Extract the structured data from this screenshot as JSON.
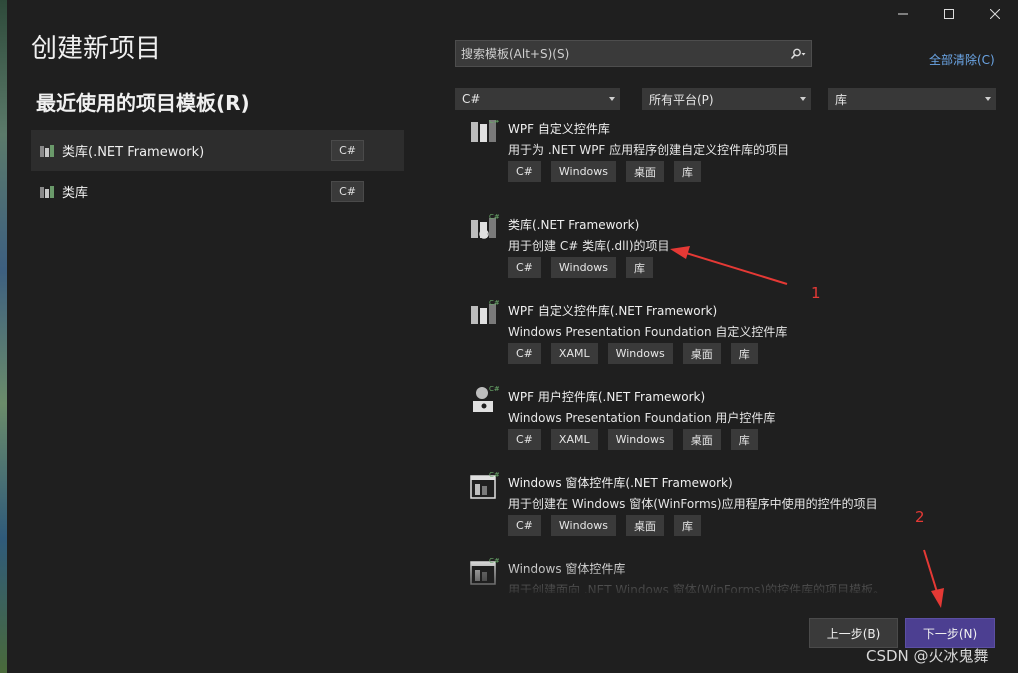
{
  "window": {
    "controls": [
      "minimize",
      "maximize",
      "close"
    ]
  },
  "page": {
    "title": "创建新项目",
    "recent_title": "最近使用的项目模板(R)",
    "recent_items": [
      {
        "label": "类库(.NET Framework)",
        "lang": "C#"
      },
      {
        "label": "类库",
        "lang": "C#"
      }
    ]
  },
  "search": {
    "placeholder": "搜索模板(Alt+S)(S)"
  },
  "clear_all": "全部清除(C)",
  "filters": {
    "language": "C#",
    "platform": "所有平台(P)",
    "project_type": "库"
  },
  "templates": [
    {
      "name": "WPF 自定义控件库",
      "desc": "用于为 .NET WPF 应用程序创建自定义控件库的项目",
      "tags": [
        "C#",
        "Windows",
        "桌面",
        "库"
      ]
    },
    {
      "name": "类库(.NET Framework)",
      "desc": "用于创建 C# 类库(.dll)的项目",
      "tags": [
        "C#",
        "Windows",
        "库"
      ]
    },
    {
      "name": "WPF 自定义控件库(.NET Framework)",
      "desc": "Windows Presentation Foundation 自定义控件库",
      "tags": [
        "C#",
        "XAML",
        "Windows",
        "桌面",
        "库"
      ]
    },
    {
      "name": "WPF 用户控件库(.NET Framework)",
      "desc": "Windows Presentation Foundation 用户控件库",
      "tags": [
        "C#",
        "XAML",
        "Windows",
        "桌面",
        "库"
      ]
    },
    {
      "name": "Windows 窗体控件库(.NET Framework)",
      "desc": "用于创建在 Windows 窗体(WinForms)应用程序中使用的控件的项目",
      "tags": [
        "C#",
        "Windows",
        "桌面",
        "库"
      ]
    },
    {
      "name": "Windows 窗体控件库",
      "desc": "用于创建面向 .NET Windows 窗体(WinForms)的控件库的项目模板。",
      "tags": []
    }
  ],
  "annotations": {
    "marker1": "1",
    "marker2": "2",
    "color": "#e53935"
  },
  "buttons": {
    "prev": "上一步(B)",
    "next": "下一步(N)"
  },
  "watermark": "CSDN @火冰鬼舞",
  "colors": {
    "background": "#1f1f1f",
    "accent": "#4c3f91",
    "link": "#6ba5e5"
  }
}
